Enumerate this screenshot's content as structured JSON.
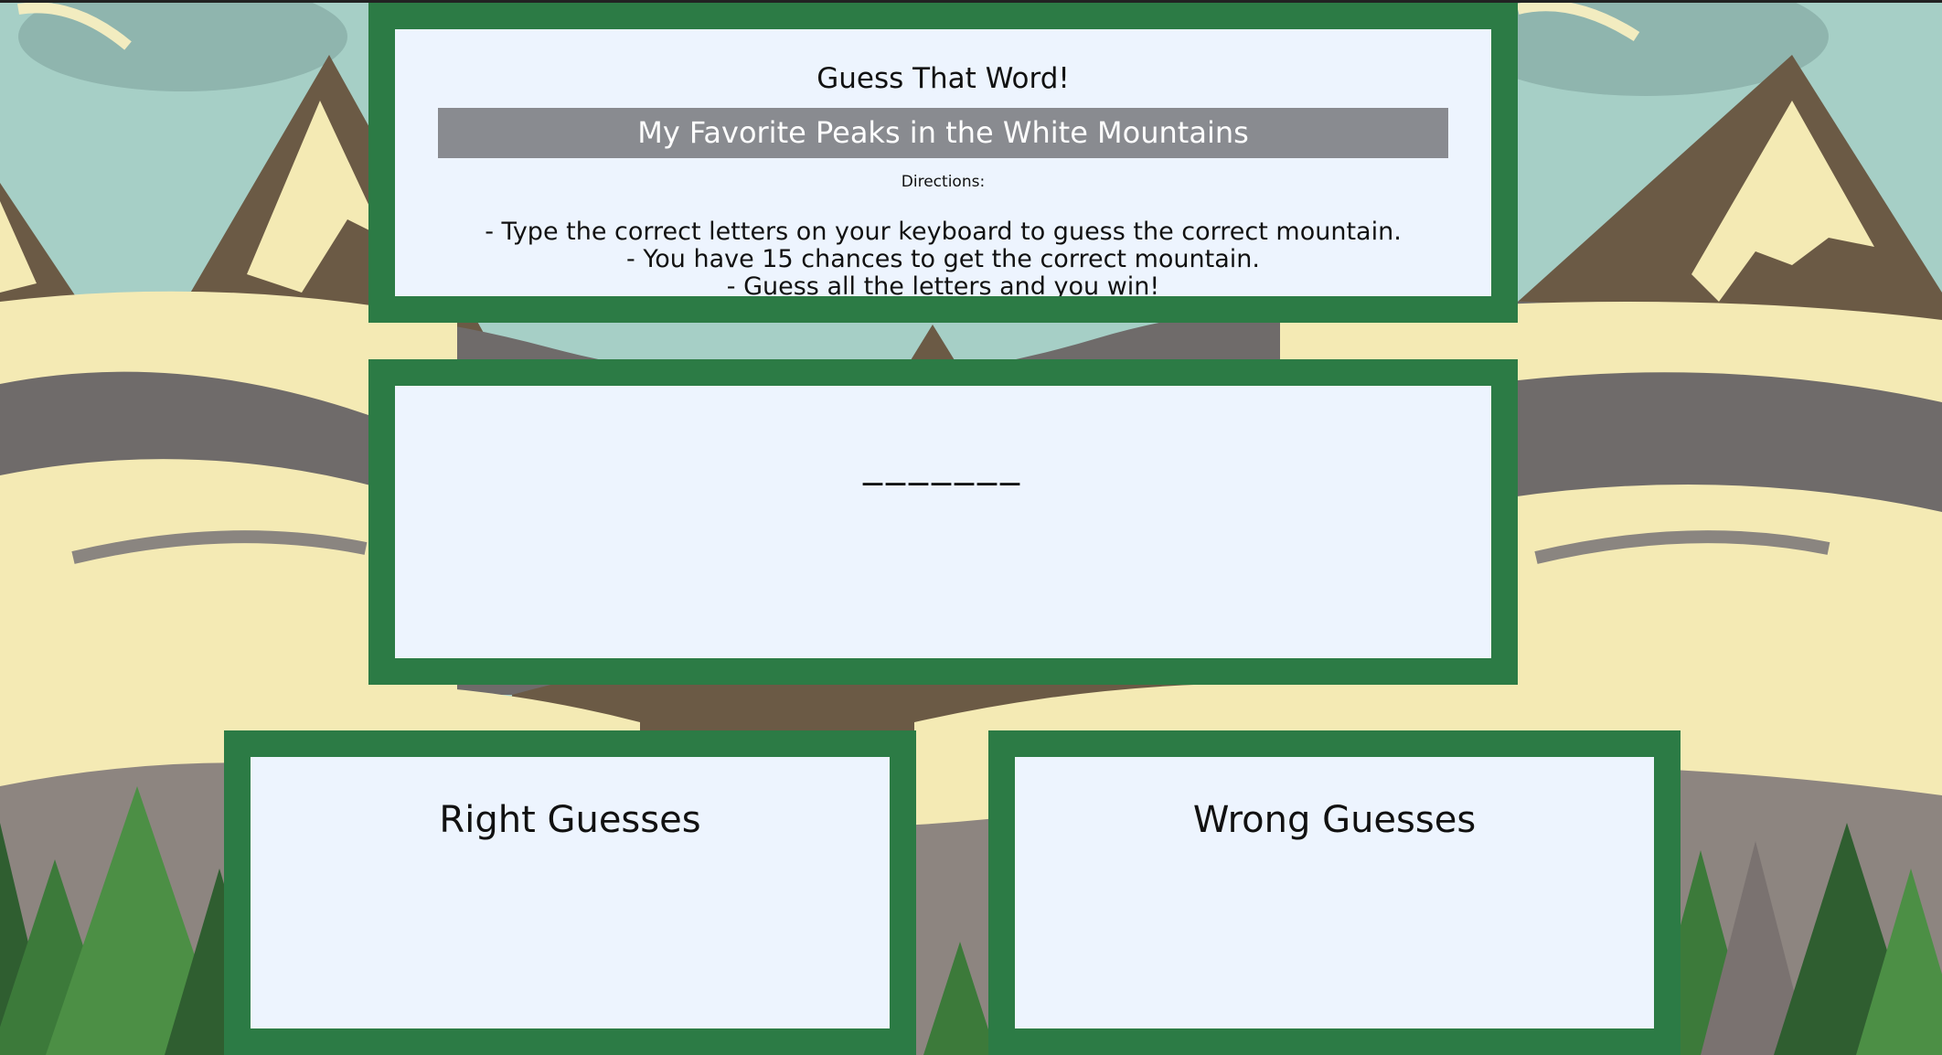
{
  "header": {
    "title": "Guess That Word!",
    "subtitle": "My Favorite Peaks in the White Mountains",
    "directions_label": "Directions:",
    "directions": [
      "- Type the correct letters on your keyboard to guess the correct mountain.",
      "- You have 15 chances to get the correct mountain.",
      "- Guess all the letters and you win!"
    ]
  },
  "word": {
    "blanks": "_______"
  },
  "right_guesses": {
    "heading": "Right Guesses",
    "letters": ""
  },
  "wrong_guesses": {
    "heading": "Wrong Guesses",
    "letters": ""
  },
  "colors": {
    "panel_border": "#2c7b45",
    "panel_fill": "#edf4fe",
    "subtitle_bar": "#898b90",
    "sky": "#a6cfc6",
    "mountain": "#6b5a45",
    "snow": "#f4eab4",
    "trees": "#3c7a3a"
  },
  "icons": [
    "mountain-landscape-background"
  ]
}
